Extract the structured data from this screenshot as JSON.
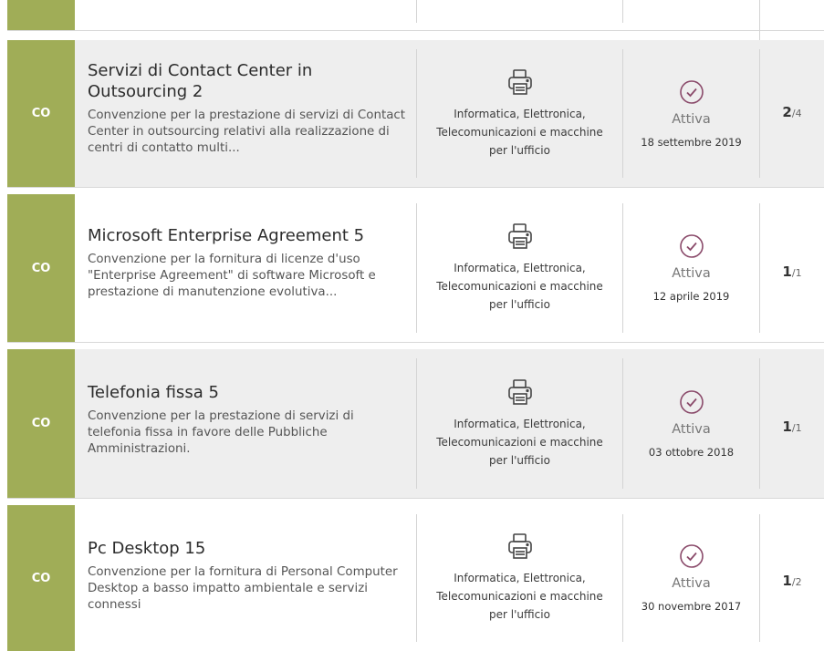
{
  "partial_row": {
    "badge": ""
  },
  "rows": [
    {
      "badge": "CO",
      "title": "Servizi di Contact Center in Outsourcing 2",
      "description": "Convenzione per la prestazione di servizi di Contact Center in outsourcing relativi alla realizzazione di centri di contatto multi...",
      "category_icon": "printer-icon",
      "category_line1": "Informatica, Elettronica,",
      "category_line2": "Telecomunicazioni e macchine",
      "category_line3": "per l'ufficio",
      "status_icon": "check-circle-icon",
      "status": "Attiva",
      "date": "18 settembre 2019",
      "lot_current": "2",
      "lot_total": "/4"
    },
    {
      "badge": "CO",
      "title": "Microsoft Enterprise Agreement 5",
      "description": "Convenzione per la fornitura di licenze d'uso \"Enterprise Agreement\" di software Microsoft e prestazione di manutenzione evolutiva...",
      "category_icon": "printer-icon",
      "category_line1": "Informatica, Elettronica,",
      "category_line2": "Telecomunicazioni e macchine",
      "category_line3": "per l'ufficio",
      "status_icon": "check-circle-icon",
      "status": "Attiva",
      "date": "12 aprile 2019",
      "lot_current": "1",
      "lot_total": "/1"
    },
    {
      "badge": "CO",
      "title": "Telefonia fissa 5",
      "description": "Convenzione per la prestazione di servizi di telefonia fissa in favore delle Pubbliche Amministrazioni.",
      "category_icon": "printer-icon",
      "category_line1": "Informatica, Elettronica,",
      "category_line2": "Telecomunicazioni e macchine",
      "category_line3": "per l'ufficio",
      "status_icon": "check-circle-icon",
      "status": "Attiva",
      "date": "03 ottobre 2018",
      "lot_current": "1",
      "lot_total": "/1"
    },
    {
      "badge": "CO",
      "title": "Pc Desktop 15",
      "description": "Convenzione per la fornitura di Personal Computer Desktop a basso impatto ambientale e servizi connessi",
      "category_icon": "printer-icon",
      "category_line1": "Informatica, Elettronica,",
      "category_line2": "Telecomunicazioni e macchine",
      "category_line3": "per l'ufficio",
      "status_icon": "check-circle-icon",
      "status": "Attiva",
      "date": "30 novembre 2017",
      "lot_current": "1",
      "lot_total": "/2"
    }
  ],
  "colors": {
    "badge": "#a0ad57",
    "status_icon": "#8a4a6a",
    "row_shade": "#eeeeee"
  }
}
